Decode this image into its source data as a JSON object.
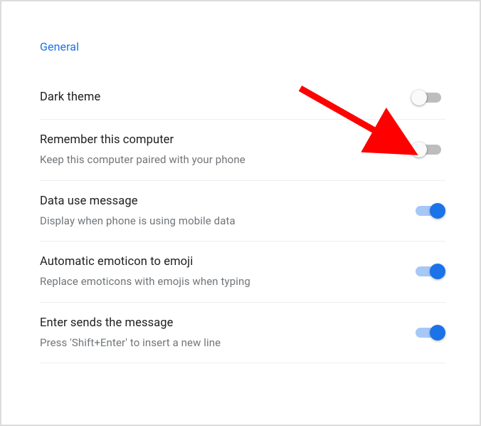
{
  "section_title": "General",
  "settings": [
    {
      "title": "Dark theme",
      "subtitle": "",
      "on": false
    },
    {
      "title": "Remember this computer",
      "subtitle": "Keep this computer paired with your phone",
      "on": false
    },
    {
      "title": "Data use message",
      "subtitle": "Display when phone is using mobile data",
      "on": true
    },
    {
      "title": "Automatic emoticon to emoji",
      "subtitle": "Replace emoticons with emojis when typing",
      "on": true
    },
    {
      "title": "Enter sends the message",
      "subtitle": "Press 'Shift+Enter' to insert a new line",
      "on": true
    }
  ],
  "annotation": {
    "color": "#ff0000"
  }
}
